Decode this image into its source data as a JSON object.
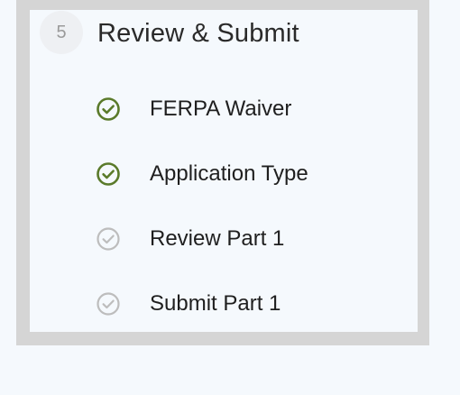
{
  "step": {
    "number": "5",
    "title": "Review & Submit"
  },
  "substeps": [
    {
      "label": "FERPA Waiver",
      "status": "complete",
      "icon": "check-circle-icon",
      "color": "#5a7a2a"
    },
    {
      "label": "Application Type",
      "status": "complete",
      "icon": "check-circle-icon",
      "color": "#5a7a2a"
    },
    {
      "label": "Review Part 1",
      "status": "incomplete",
      "icon": "check-circle-icon",
      "color": "#bdbdbd"
    },
    {
      "label": "Submit Part 1",
      "status": "incomplete",
      "icon": "check-circle-icon",
      "color": "#bdbdbd"
    }
  ],
  "colors": {
    "page_background": "#f5f9fd",
    "frame_border": "#d5d5d5",
    "complete": "#5a7a2a",
    "incomplete": "#bdbdbd"
  }
}
